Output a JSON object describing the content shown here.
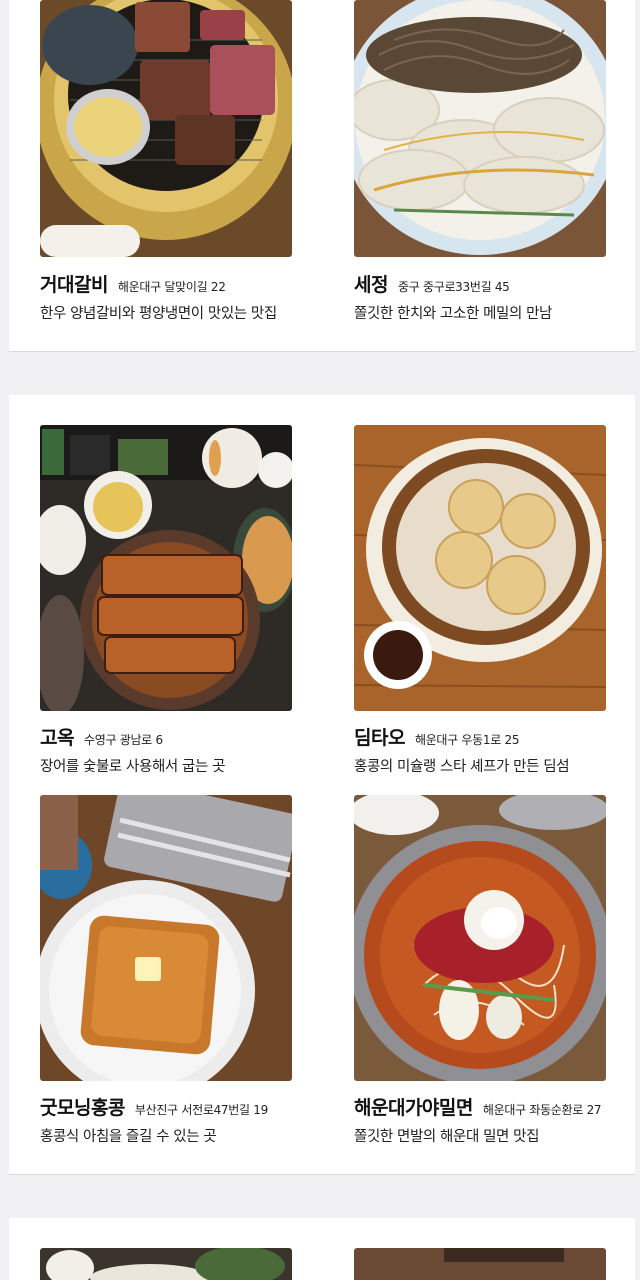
{
  "restaurants": [
    {
      "name": "거대갈비",
      "address": "해운대구 달맞이길 22",
      "description": "한우 양념갈비와 평양냉면이 맛있는 맛집",
      "photo": "grilled-galbi-photo"
    },
    {
      "name": "세정",
      "address": "중구 중구로33번길 45",
      "description": "쫄깃한 한치와 고소한 메밀의 만남",
      "photo": "buckwheat-noodle-squid-photo"
    },
    {
      "name": "고옥",
      "address": "수영구 광남로 6",
      "description": "장어를 숯불로 사용해서 굽는 곳",
      "photo": "grilled-eel-rice-photo"
    },
    {
      "name": "딤타오",
      "address": "해운대구 우동1로 25",
      "description": "홍콩의 미슐랭 스타 셰프가 만든 딤섬",
      "photo": "dim-sum-steamer-photo"
    },
    {
      "name": "굿모닝홍콩",
      "address": "부산진구 서전로47번길 19",
      "description": "홍콩식 아침을 즐길 수 있는 곳",
      "photo": "hk-french-toast-photo"
    },
    {
      "name": "해운대가야밀면",
      "address": "해운대구 좌동순환로 27",
      "description": "쫄깃한 면발의 해운대 밀면 맛집",
      "photo": "cold-milmyeon-photo"
    }
  ],
  "colors": {
    "page_bg": "#f1f1f3",
    "card_bg": "#ffffff",
    "divider": "#d8d8dc"
  }
}
